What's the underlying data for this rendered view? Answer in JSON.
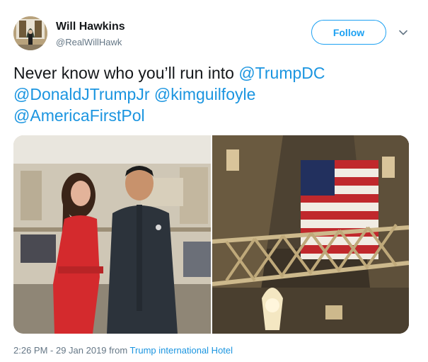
{
  "user": {
    "name": "Will Hawkins",
    "handle": "@RealWillHawk"
  },
  "follow_button": {
    "label": "Follow"
  },
  "tweet": {
    "text_parts": [
      {
        "text": "Never know who you’ll run into ",
        "type": "text"
      },
      {
        "text": "@TrumpDC",
        "type": "mention"
      },
      {
        "text": "@DonaldJTrumpJr",
        "type": "mention"
      },
      {
        "text": " ",
        "type": "text"
      },
      {
        "text": "@kimguilfoyle",
        "type": "mention"
      },
      {
        "text": "@AmericaFirstPol",
        "type": "mention"
      }
    ]
  },
  "media": {
    "photos": [
      {
        "subject": "two-people-in-hotel-lobby"
      },
      {
        "subject": "american-flag-atrium"
      }
    ]
  },
  "footer": {
    "timestamp": "2:26 PM - 29 Jan 2019",
    "from_word": "from",
    "location": "Trump international Hotel"
  },
  "colors": {
    "accent": "#1da1f2",
    "link": "#1b95e0",
    "muted": "#657786",
    "text": "#14171a"
  },
  "icons": {
    "menu": "chevron-down-icon"
  }
}
